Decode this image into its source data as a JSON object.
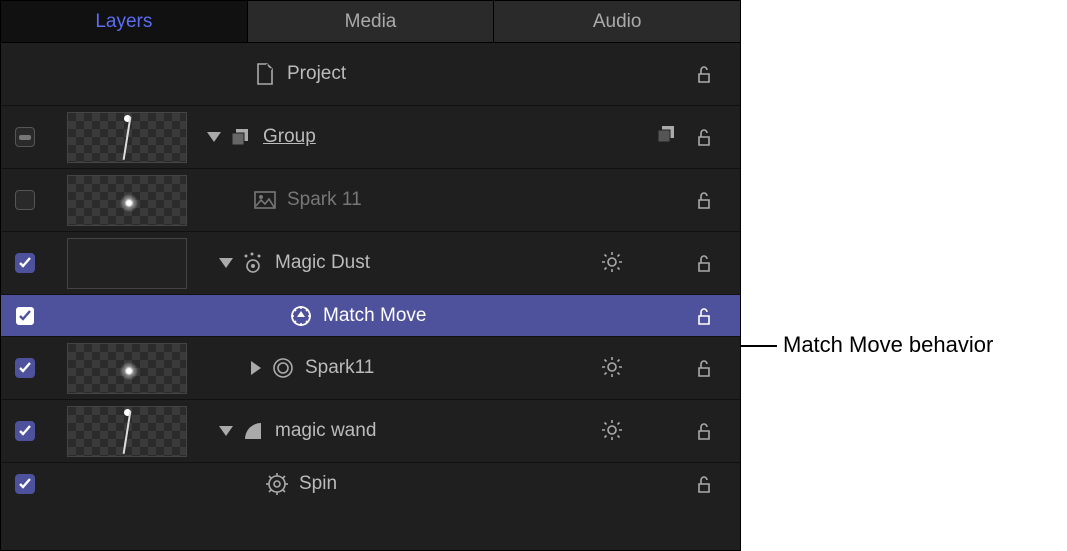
{
  "tabs": {
    "layers": "Layers",
    "media": "Media",
    "audio": "Audio"
  },
  "rows": {
    "project": "Project",
    "group": "Group",
    "spark11a": "Spark 11",
    "magic_dust": "Magic Dust",
    "match_move": "Match Move",
    "spark11b": "Spark11",
    "magic_wand": "magic wand",
    "spin": "Spin"
  },
  "callout": "Match Move behavior"
}
